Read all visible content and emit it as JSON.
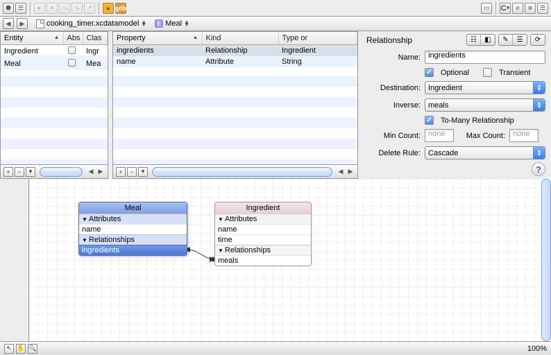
{
  "crumb": {
    "file": "cooking_timer.xcdatamodel",
    "entity_prefix": "E",
    "entity": "Meal"
  },
  "toolbar_right": {
    "c_label": "C"
  },
  "entity_panel": {
    "cols": [
      "Entity",
      "Abs",
      "Clas"
    ],
    "rows": [
      {
        "name": "Ingredient",
        "cls": "Ingr"
      },
      {
        "name": "Meal",
        "cls": "Mea"
      }
    ]
  },
  "property_panel": {
    "cols": [
      "Property",
      "Kind",
      "Type or"
    ],
    "rows": [
      {
        "name": "ingredients",
        "kind": "Relationship",
        "type": "Ingredient"
      },
      {
        "name": "name",
        "kind": "Attribute",
        "type": "String"
      }
    ]
  },
  "inspector": {
    "heading": "Relationship",
    "name_label": "Name:",
    "name_value": "ingredients",
    "optional": "Optional",
    "transient": "Transient",
    "destination_label": "Destination:",
    "destination_value": "Ingredient",
    "inverse_label": "Inverse:",
    "inverse_value": "meals",
    "tomany": "To-Many Relationship",
    "mincount_label": "Min Count:",
    "mincount_value": "none",
    "maxcount_label": "Max Count:",
    "maxcount_value": "none",
    "deleterule_label": "Delete Rule:",
    "deleterule_value": "Cascade"
  },
  "diagram": {
    "meal": {
      "title": "Meal",
      "attrs_label": "Attributes",
      "a1": "name",
      "rels_label": "Relationships",
      "r1": "ingredients"
    },
    "ing": {
      "title": "Ingredient",
      "attrs_label": "Attributes",
      "a1": "name",
      "a2": "time",
      "rels_label": "Relationships",
      "r1": "meals"
    }
  },
  "status": {
    "zoom": "100%"
  },
  "chart_data": {
    "type": "diagram",
    "entities": [
      {
        "name": "Meal",
        "attributes": [
          "name"
        ],
        "relationships": [
          "ingredients"
        ]
      },
      {
        "name": "Ingredient",
        "attributes": [
          "name",
          "time"
        ],
        "relationships": [
          "meals"
        ]
      }
    ],
    "relationships": [
      {
        "from": "Meal.ingredients",
        "to": "Ingredient",
        "inverse": "Ingredient.meals",
        "to_many": true
      }
    ]
  }
}
